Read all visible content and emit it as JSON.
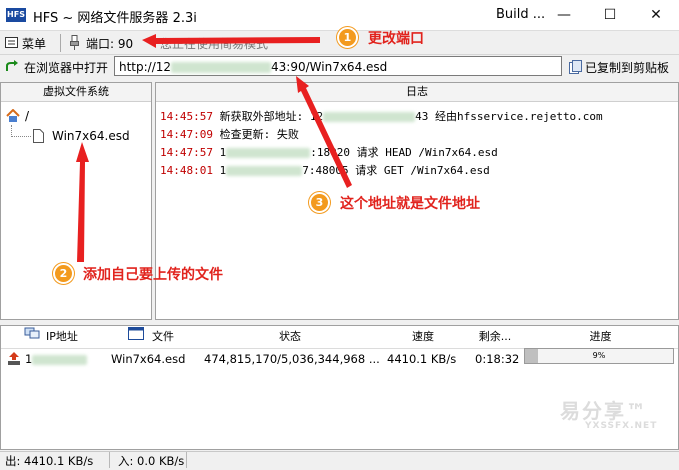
{
  "window": {
    "logo_text": "HFS",
    "title": "HFS ~ 网络文件服务器 2.3i",
    "build": "Build ...",
    "min_glyph": "—",
    "max_glyph": "☐",
    "close_glyph": "✕"
  },
  "toolbar": {
    "menu_label": "菜单",
    "port_label": "端口: 90",
    "faded_mode_text": "您正在使用简易模式"
  },
  "url_row": {
    "open_in_browser_label": "在浏览器中打开",
    "url_value": "http://125.XXX.XXX.143:90/Win7x64.esd",
    "url_prefix": "http://12",
    "url_suffix": "43:90/Win7x64.esd",
    "copied_label": "已复制到剪贴板"
  },
  "vfs": {
    "header": "虚拟文件系统",
    "root": "/",
    "file": "Win7x64.esd"
  },
  "log": {
    "header": "日志",
    "lines": [
      {
        "time": "14:45:57",
        "pre": "新获取外部地址: 12",
        "post": "43 经由hfsservice.rejetto.com"
      },
      {
        "time": "14:47:09",
        "pre": "检查更新: 失败",
        "post": ""
      },
      {
        "time": "14:47:57",
        "pre": "1",
        "post": ":18020 请求 HEAD /Win7x64.esd"
      },
      {
        "time": "14:48:01",
        "pre": "1",
        "post": "7:48005 请求 GET /Win7x64.esd"
      }
    ]
  },
  "transfers": {
    "headers": {
      "ip": "IP地址",
      "file": "文件",
      "status": "状态",
      "speed": "速度",
      "remaining": "剩余...",
      "progress": "进度"
    },
    "row": {
      "ip": "1",
      "file": "Win7x64.esd",
      "status": "474,815,170/5,036,344,968 ...",
      "speed": "4410.1 KB/s",
      "remaining": "0:18:32",
      "progress_label": "9%",
      "progress_fraction": 0.09
    }
  },
  "statusbar": {
    "out": "出: 4410.1 KB/s",
    "in": "入: 0.0 KB/s"
  },
  "annotations": {
    "a1_num": "1",
    "a1_text": "更改端口",
    "a2_num": "2",
    "a2_text": "添加自己要上传的文件",
    "a3_num": "3",
    "a3_text": "这个地址就是文件地址"
  },
  "watermark": {
    "main": "易分享™",
    "sub": "YXSSFX.NET"
  },
  "colors": {
    "log_time": "#c00000",
    "annotation": "#e1231d",
    "badge": "#f39a1e"
  }
}
